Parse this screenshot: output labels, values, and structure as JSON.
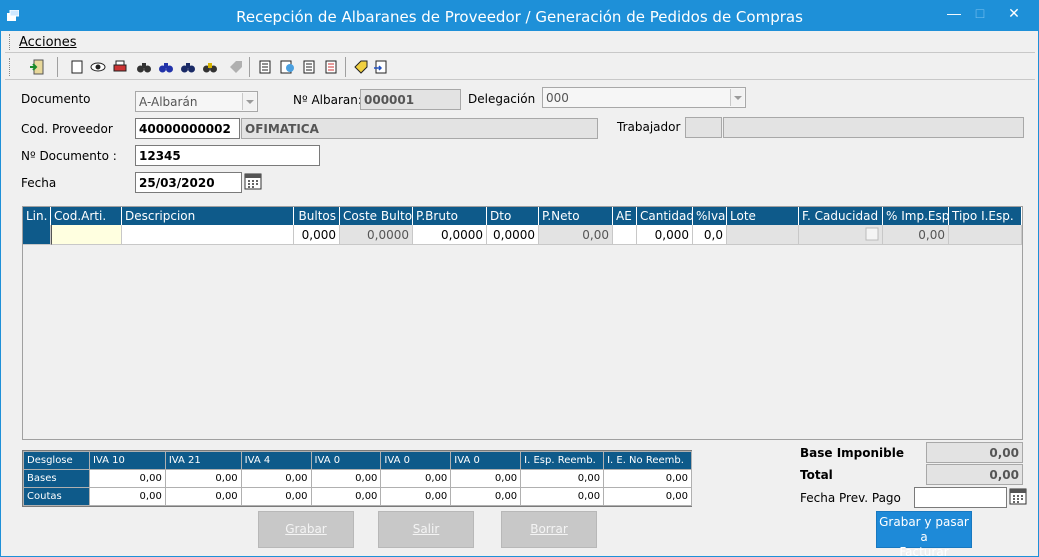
{
  "window": {
    "title": "Recepción de Albaranes de Proveedor / Generación de Pedidos de Compras",
    "minimize": "—",
    "maximize": "□",
    "close": "✕"
  },
  "menu": {
    "acciones": "Acciones"
  },
  "toolbar": {
    "icons": [
      "exit-icon",
      "new-document-icon",
      "view-icon",
      "print-icon",
      "search-binoculars-icon",
      "search-binoculars-blue-icon",
      "search-binoculars-dark-icon",
      "search-binoculars-yellow-icon",
      "tag-disabled-icon",
      "document-list-icon",
      "document-link-icon",
      "document-copy-icon",
      "document-red-icon",
      "tag-edit-icon",
      "document-export-icon"
    ]
  },
  "form": {
    "documento_label": "Documento",
    "documento_value": "A-Albarán",
    "n_albaran_label": "Nº Albaran:",
    "n_albaran_value": "000001",
    "delegacion_label": "Delegación",
    "delegacion_value": "000",
    "cod_proveedor_label": "Cod. Proveedor",
    "cod_proveedor_value": "40000000002",
    "proveedor_nombre": "OFIMATICA",
    "trabajador_label": "Trabajador",
    "trabajador_code": "",
    "trabajador_name": "",
    "n_documento_label": "Nº Documento :",
    "n_documento_value": "12345",
    "fecha_label": "Fecha",
    "fecha_value": "25/03/2020"
  },
  "grid": {
    "columns": [
      "Lin.",
      "Cod.Arti.",
      "Descripcion",
      "Bultos",
      "Coste Bulto",
      "P.Bruto",
      "Dto",
      "P.Neto",
      "AE",
      "Cantidad",
      "%Iva",
      "Lote",
      "F. Caducidad",
      "% Imp.Esp",
      "Tipo I.Esp."
    ],
    "row": {
      "lin": "",
      "cod": "",
      "desc": "",
      "bultos": "0,000",
      "coste": "0,0000",
      "bruto": "0,0000",
      "dto": "0,0000",
      "neto": "0,00",
      "ae": "",
      "cantidad": "0,000",
      "iva": "0,0",
      "lote": "",
      "caducidad": "",
      "imp_esp": "0,00",
      "tipo": ""
    }
  },
  "totals": {
    "headers": [
      "Desglose",
      "IVA 10",
      "IVA 21",
      "IVA 4",
      "IVA 0",
      "IVA 0",
      "IVA 0",
      "I. Esp. Reemb.",
      "I. E. No Reemb."
    ],
    "bases_label": "Bases",
    "bases": [
      "0,00",
      "0,00",
      "0,00",
      "0,00",
      "0,00",
      "0,00",
      "0,00",
      "0,00"
    ],
    "cuotas_label": "Coutas",
    "cuotas": [
      "0,00",
      "0,00",
      "0,00",
      "0,00",
      "0,00",
      "0,00",
      "0,00",
      "0,00"
    ]
  },
  "summary": {
    "base_label": "Base Imponible",
    "base_value": "0,00",
    "total_label": "Total",
    "total_value": "0,00",
    "fecha_pago_label": "Fecha Prev. Pago",
    "fecha_pago_value": ""
  },
  "buttons": {
    "grabar": "Grabar",
    "salir": "Salir",
    "borrar": "Borrar",
    "grabar_facturar_1": "Grabar y pasar a",
    "grabar_facturar_2": "Facturar"
  },
  "colors": {
    "titlebar": "#1e90d8",
    "grid_header": "#0e5a8a",
    "primary_button": "#1e8ad8"
  }
}
